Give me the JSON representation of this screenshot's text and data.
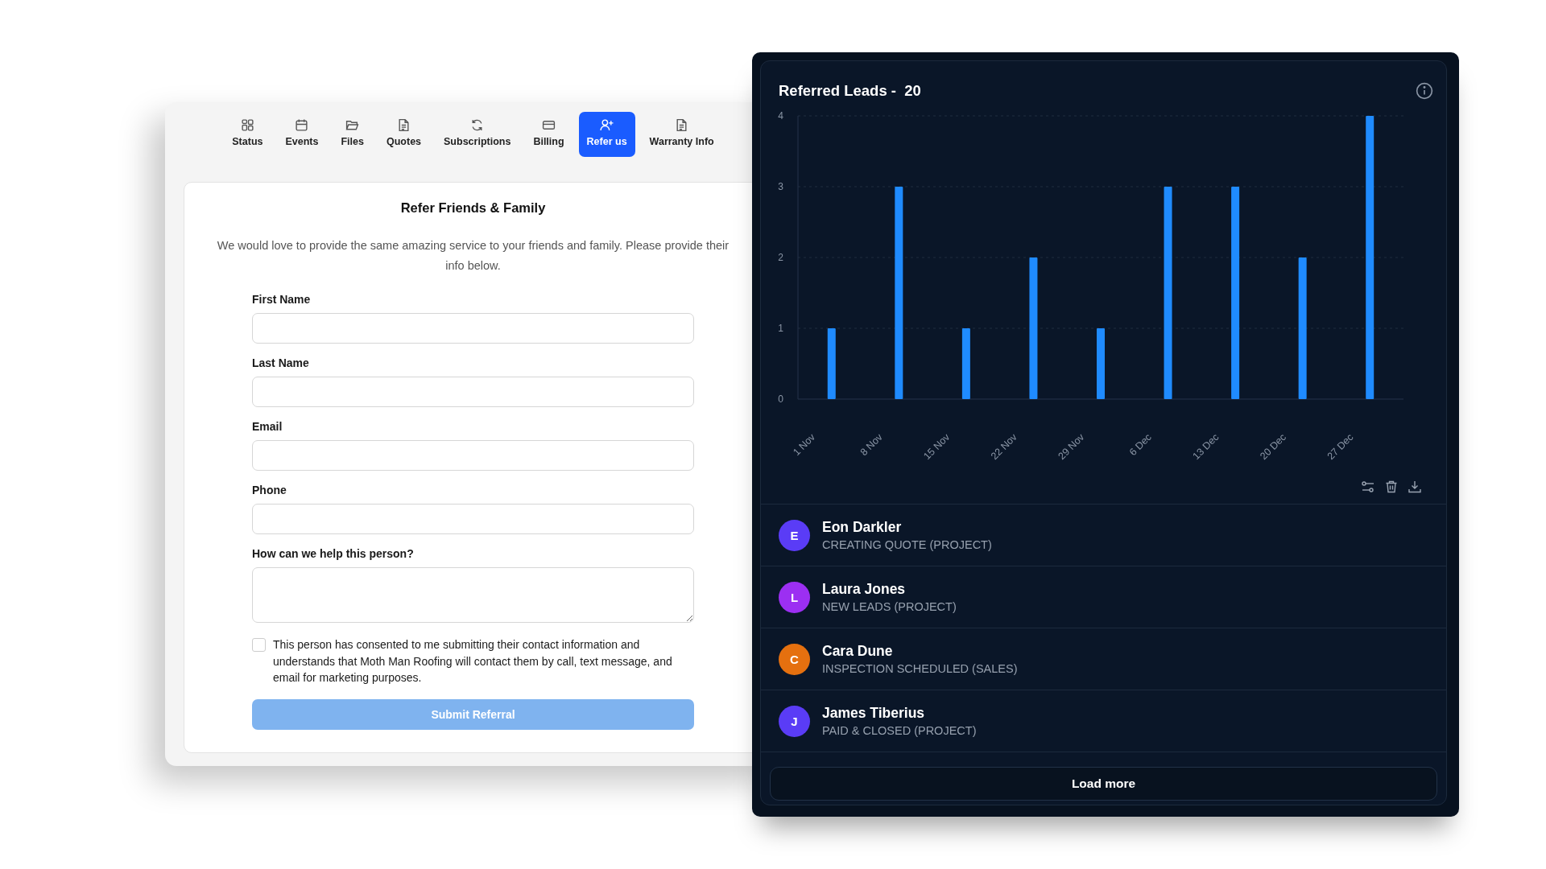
{
  "tabs": [
    {
      "label": "Status",
      "selected": false
    },
    {
      "label": "Events",
      "selected": false
    },
    {
      "label": "Files",
      "selected": false
    },
    {
      "label": "Quotes",
      "selected": false
    },
    {
      "label": "Subscriptions",
      "selected": false
    },
    {
      "label": "Billing",
      "selected": false
    },
    {
      "label": "Refer us",
      "selected": true
    },
    {
      "label": "Warranty Info",
      "selected": false
    }
  ],
  "form": {
    "title": "Refer Friends & Family",
    "description": "We would love to provide the same amazing service to your friends and family. Please provide their info below.",
    "fields": [
      {
        "label": "First Name",
        "kind": "input"
      },
      {
        "label": "Last Name",
        "kind": "input"
      },
      {
        "label": "Email",
        "kind": "input"
      },
      {
        "label": "Phone",
        "kind": "input"
      },
      {
        "label": "How can we help this person?",
        "kind": "textarea"
      }
    ],
    "consent": {
      "text": "This person has consented to me submitting their contact information and understands that Moth Man Roofing will contact them by call, text message, and email for marketing purposes.",
      "checked": false
    },
    "submit": {
      "label": "Submit Referral",
      "disabled": true
    }
  },
  "leads_panel": {
    "title": "Referred Leads -",
    "count": "20",
    "chart_data": {
      "type": "bar",
      "categories": [
        "1 Nov",
        "8 Nov",
        "15 Nov",
        "22 Nov",
        "29 Nov",
        "6 Dec",
        "13 Dec",
        "20 Dec",
        "27 Dec"
      ],
      "values": [
        1,
        3,
        1,
        2,
        1,
        3,
        3,
        2,
        4
      ],
      "ylim": [
        0,
        4
      ],
      "yticks": [
        0,
        1,
        2,
        3,
        4
      ],
      "grid": true
    },
    "leads": [
      {
        "initial": "E",
        "name": "Eon Darkler",
        "status": "CREATING QUOTE (PROJECT)",
        "color": "#5a3cf6"
      },
      {
        "initial": "L",
        "name": "Laura Jones",
        "status": "NEW LEADS (PROJECT)",
        "color": "#9c2ff2"
      },
      {
        "initial": "C",
        "name": "Cara Dune",
        "status": "INSPECTION SCHEDULED (SALES)",
        "color": "#e5700f"
      },
      {
        "initial": "J",
        "name": "James Tiberius",
        "status": "PAID & CLOSED (PROJECT)",
        "color": "#5a3cf6"
      }
    ],
    "load_more": "Load more"
  }
}
